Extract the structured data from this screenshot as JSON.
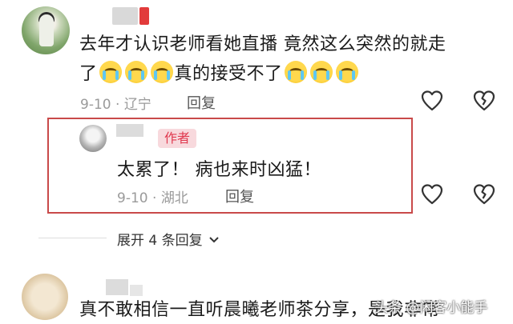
{
  "comment1": {
    "line1": "去年才认识老师看她直播 竟然这么突然的就走",
    "line2_prefix": "了",
    "line2_mid": "真的接受不了",
    "date": "9-10",
    "location": "辽宁",
    "reply_label": "回复",
    "crying_emoji_icon": "crying-face-icon"
  },
  "reply": {
    "author_tag": "作者",
    "text": "太累了！ 病也来时凶猛！",
    "date": "9-10",
    "location": "湖北",
    "reply_label": "回复"
  },
  "expand_text": "展开 4 条回复",
  "comment2": {
    "text": "真不敢相信一直听晨曦老师茶分享，是我非常"
  },
  "watermark": "头条 @闲客小能手",
  "colors": {
    "highlight_border": "#c94a4a",
    "author_tag_bg": "#f8d9dd",
    "author_tag_text": "#e0394f"
  }
}
